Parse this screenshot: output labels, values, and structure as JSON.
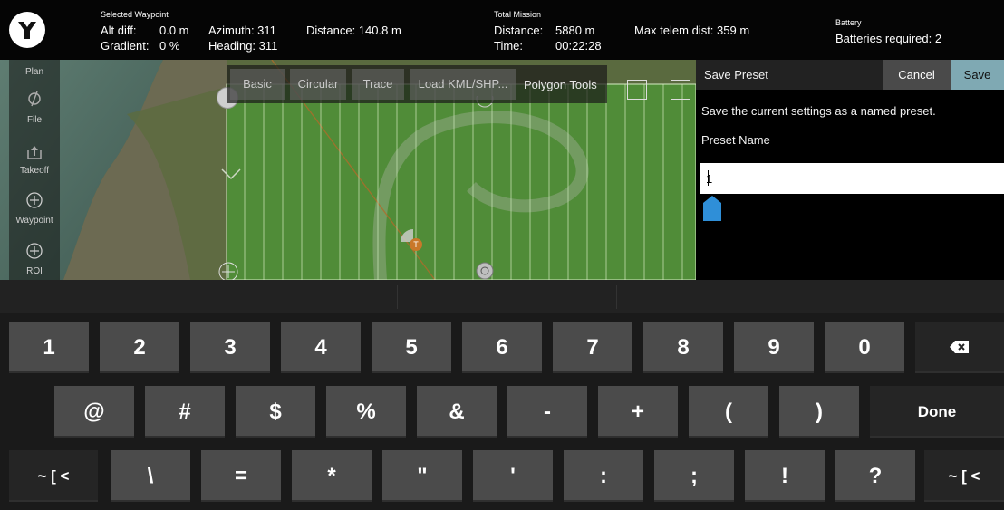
{
  "topbar": {
    "selected_waypoint_label": "Selected Waypoint",
    "alt_diff_label": "Alt diff:",
    "alt_diff_value": "0.0 m",
    "gradient_label": "Gradient:",
    "gradient_value": "0 %",
    "azimuth": "Azimuth: 311",
    "heading": "Heading: 311",
    "distance": "Distance: 140.8 m",
    "total_mission_label": "Total Mission",
    "mission_distance_label": "Distance:",
    "mission_distance_value": "5880 m",
    "mission_time_label": "Time:",
    "mission_time_value": "00:22:28",
    "max_telem": "Max telem dist: 359 m",
    "battery_label": "Battery",
    "batteries_required": "Batteries required: 2"
  },
  "rail": {
    "plan": "Plan",
    "file": "File",
    "takeoff": "Takeoff",
    "waypoint": "Waypoint",
    "roi": "ROI"
  },
  "tools": {
    "tabs": [
      "Basic",
      "Circular",
      "Trace",
      "Load KML/SHP..."
    ],
    "title": "Polygon Tools"
  },
  "map": {
    "takeoff_marker": "T"
  },
  "panel": {
    "title": "Save Preset",
    "cancel": "Cancel",
    "save": "Save",
    "description": "Save the current settings as a named preset.",
    "field_label": "Preset Name",
    "field_value": "1"
  },
  "keyboard": {
    "row1": [
      "1",
      "2",
      "3",
      "4",
      "5",
      "6",
      "7",
      "8",
      "9",
      "0"
    ],
    "row2": [
      "@",
      "#",
      "$",
      "%",
      "&",
      "-",
      "+",
      "(",
      ")"
    ],
    "done": "Done",
    "row3": [
      "\\",
      "=",
      "*",
      "\"",
      "'",
      ":",
      ";",
      "!",
      "?"
    ],
    "alt_left": "~ [ <",
    "alt_right": "~ [ <"
  },
  "colors": {
    "save_button": "#7fa9b3",
    "survey_grid": "#7aa84e",
    "selection_handle": "#2f8fd8"
  }
}
